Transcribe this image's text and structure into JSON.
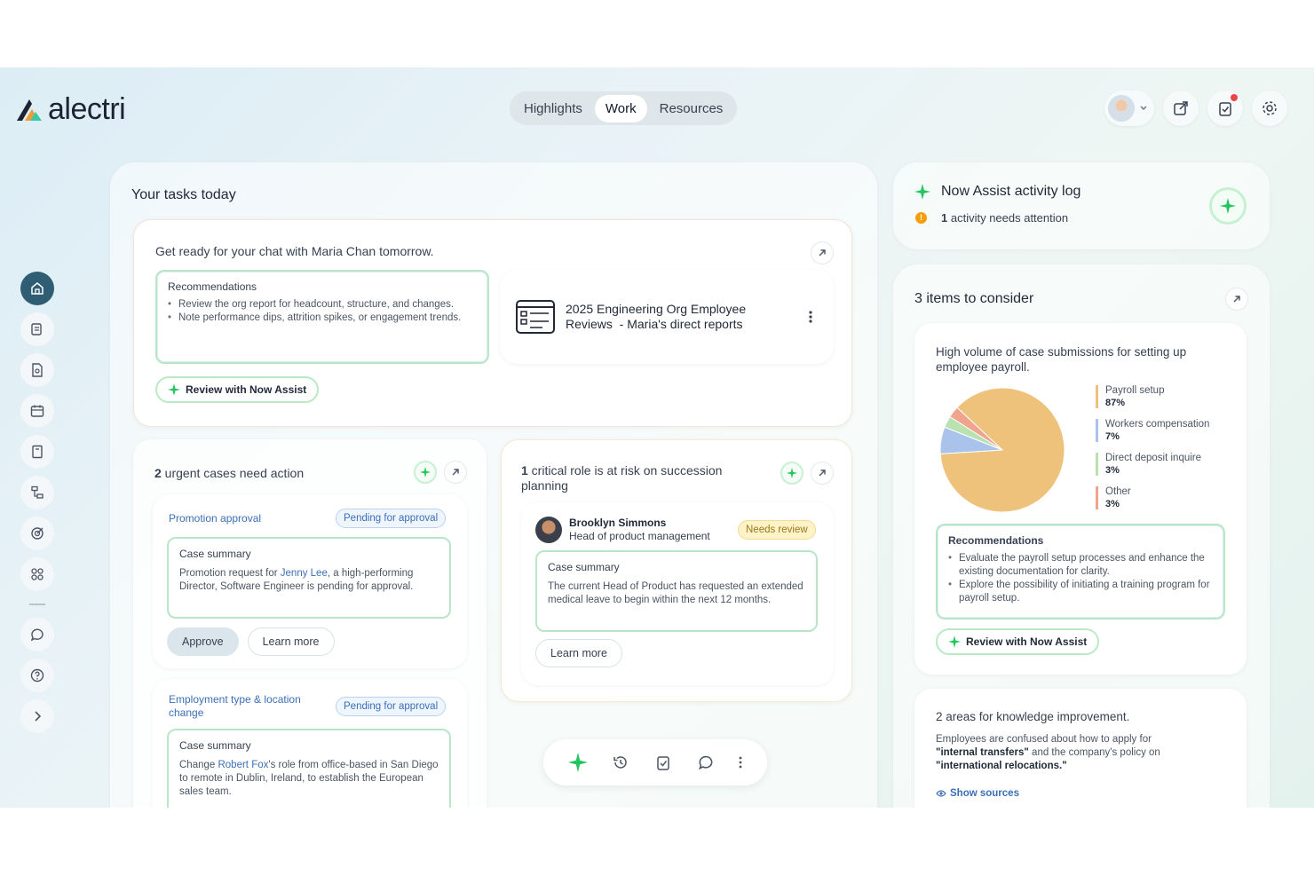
{
  "app": {
    "logo_text": "alectri"
  },
  "header": {
    "tabs": [
      {
        "label": "Highlights",
        "active": false
      },
      {
        "label": "Work",
        "active": true
      },
      {
        "label": "Resources",
        "active": false
      }
    ]
  },
  "colors": {
    "accent_green": "#22c55e",
    "home_nav": "#2f5d73",
    "link_blue": "#3b6fb6",
    "alert_orange": "#f59e0b"
  },
  "tasks": {
    "title": "Your tasks today",
    "chat_card": {
      "title": "Get ready for your chat with Maria Chan tomorrow.",
      "rec_title": "Recommendations",
      "rec_items": [
        "Review the org report for headcount, structure, and changes.",
        "Note performance dips, attrition spikes, or engagement trends."
      ],
      "assist_label": "Review with Now Assist",
      "doc_title_line1": "2025 Engineering Org Employee",
      "doc_title_line2": "Reviews  - Maria's direct reports"
    },
    "urgent": {
      "title_count": "2",
      "title_rest": " urgent cases need action",
      "case1": {
        "type": "Promotion approval",
        "status": "Pending for approval",
        "summary_title": "Case summary",
        "text_before": "Promotion request for ",
        "person": "Jenny Lee",
        "text_after": ", a high-performing Director, Software Engineer is pending for approval.",
        "approve_label": "Approve",
        "learn_label": "Learn more"
      },
      "case2": {
        "type_line1": "Employment type & location",
        "type_line2": "change",
        "status": "Pending for approval",
        "summary_title": "Case summary",
        "text_before": "Change ",
        "person": "Robert Fox",
        "text_after": "'s role from office-based in San Diego to remote in Dublin, Ireland, to establish the European sales team."
      }
    },
    "succession": {
      "title_count": "1",
      "title_rest": " critical role is at risk on succession planning",
      "person_name": "Brooklyn Simmons",
      "person_role": "Head of product management",
      "status": "Needs review",
      "summary_title": "Case summary",
      "summary_text": "The current Head of Product has requested an extended medical leave to begin within the next 12 months.",
      "learn_label": "Learn more"
    }
  },
  "activity_log": {
    "title": "Now Assist activity log",
    "alert_count": "1",
    "alert_rest": " activity needs attention"
  },
  "consider": {
    "title": "3 items to consider",
    "payroll_card": {
      "title": "High volume of case submissions for setting up employee payroll.",
      "rec_title": "Recommendations",
      "rec_items": [
        "Evaluate the payroll setup processes and enhance the existing documentation for clarity.",
        "Explore the possibility of initiating a training program for payroll setup."
      ],
      "assist_label": "Review with Now Assist"
    },
    "knowledge_card": {
      "title": "2 areas for knowledge improvement.",
      "text_1": "Employees are confused about how to apply for",
      "text_bold1": "\"internal transfers\"",
      "text_2": " and the company's policy on",
      "text_bold2": "\"international relocations.\"",
      "sources_label": "Show sources"
    }
  },
  "chart_data": {
    "type": "pie",
    "title": "",
    "categories": [
      "Payroll setup",
      "Workers compensation",
      "Direct deposit inquire",
      "Other"
    ],
    "values": [
      87,
      7,
      3,
      3
    ],
    "labels": [
      "87%",
      "7%",
      "3%",
      "3%"
    ],
    "colors": [
      "#eec27a",
      "#a9c3ea",
      "#b9e2b0",
      "#f0a48e"
    ]
  },
  "bottom_toolbar": {
    "items": [
      "sparkle",
      "history",
      "tasks",
      "chat",
      "more"
    ]
  }
}
